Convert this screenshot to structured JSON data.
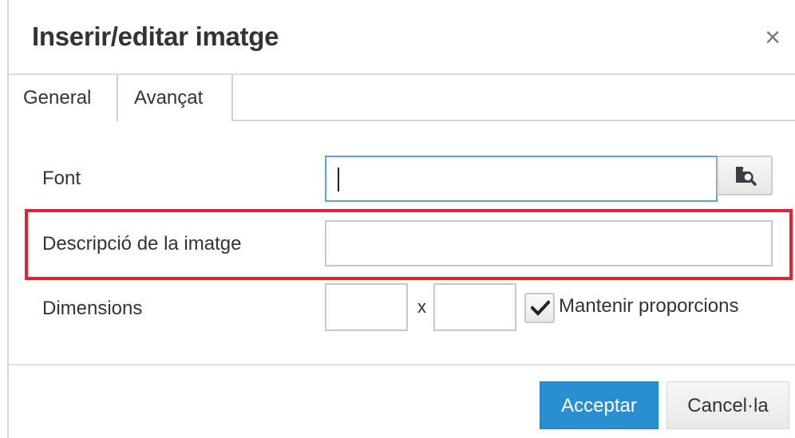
{
  "dialog": {
    "title": "Inserir/editar imatge",
    "close_icon": "close-icon",
    "close_glyph": "×"
  },
  "tabs": [
    {
      "label": "General",
      "active": true
    },
    {
      "label": "Avançat",
      "active": false
    }
  ],
  "form": {
    "source": {
      "label": "Font",
      "value": "",
      "browse_icon": "folder-search-icon"
    },
    "description": {
      "label": "Descripció de la imatge",
      "value": ""
    },
    "dimensions": {
      "label": "Dimensions",
      "width_value": "",
      "height_value": "",
      "separator": "x"
    },
    "constrain": {
      "label": "Mantenir proporcions",
      "checked": true,
      "icon": "checkmark-icon"
    }
  },
  "buttons": {
    "ok_label": "Acceptar",
    "cancel_label": "Cancel·la"
  },
  "colors": {
    "primary": "#2a8fcf",
    "highlight": "#e8202a",
    "focus": "#5aa3e0"
  }
}
